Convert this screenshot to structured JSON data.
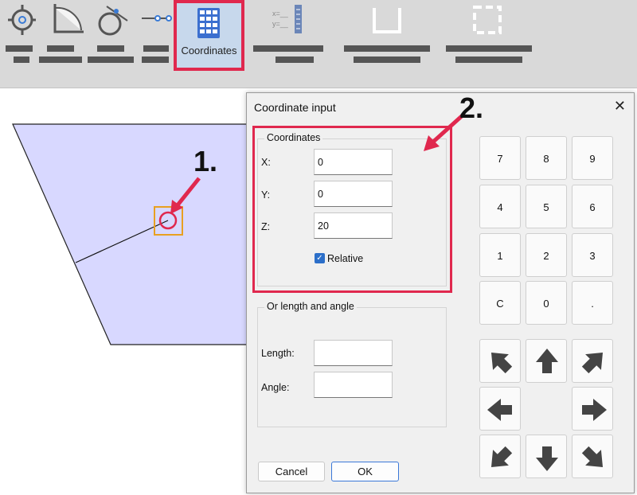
{
  "toolbar": {
    "coordinates_label": "Coordinates"
  },
  "dialog": {
    "title": "Coordinate input",
    "close_glyph": "✕",
    "coordinates_group": {
      "label": "Coordinates",
      "x_label": "X:",
      "x_value": "0",
      "y_label": "Y:",
      "y_value": "0",
      "z_label": "Z:",
      "z_value": "20",
      "relative_label": "Relative",
      "relative_checked": true
    },
    "length_angle_group": {
      "label": "Or length and angle",
      "length_label": "Length:",
      "length_value": "",
      "angle_label": "Angle:",
      "angle_value": ""
    },
    "keypad": [
      "7",
      "8",
      "9",
      "4",
      "5",
      "6",
      "1",
      "2",
      "3",
      "C",
      "0",
      "."
    ],
    "cancel_label": "Cancel",
    "ok_label": "OK"
  },
  "annotations": {
    "step1": "1.",
    "step2": "2."
  },
  "colors": {
    "highlight": "#e0284e",
    "shape_fill": "#d8d8ff",
    "snap_box": "#e8a020"
  }
}
